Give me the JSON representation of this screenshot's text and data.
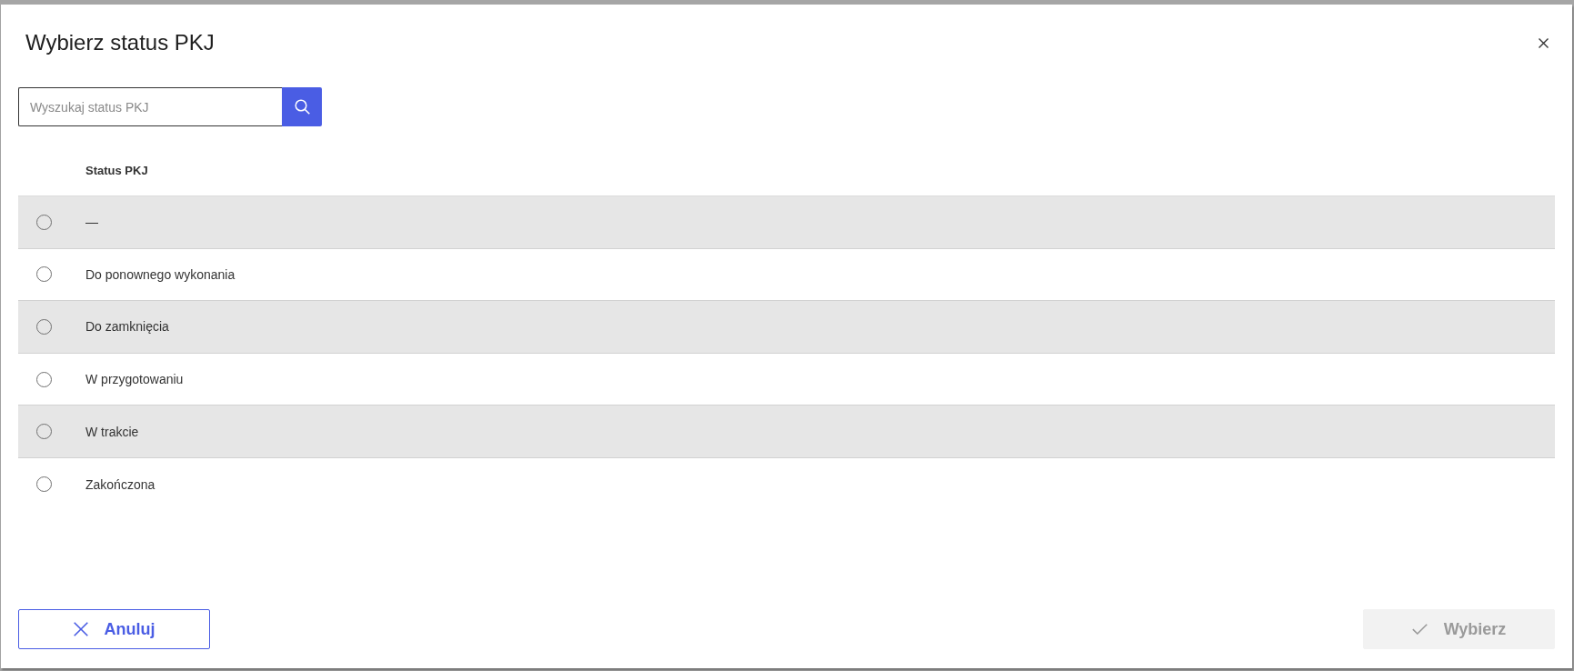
{
  "dialog": {
    "title": "Wybierz status PKJ"
  },
  "search": {
    "placeholder": "Wyszukaj status PKJ"
  },
  "table": {
    "columns": [
      "Status PKJ"
    ],
    "rows": [
      {
        "status": "—",
        "selected": false
      },
      {
        "status": "Do ponownego wykonania",
        "selected": false
      },
      {
        "status": "Do zamknięcia",
        "selected": false
      },
      {
        "status": "W przygotowaniu",
        "selected": false
      },
      {
        "status": "W trakcie",
        "selected": false
      },
      {
        "status": "Zakończona",
        "selected": false
      }
    ]
  },
  "buttons": [
    {
      "label": "Anuluj",
      "kind": "cancel",
      "disabled": false
    },
    {
      "label": "Wybierz",
      "kind": "confirm",
      "disabled": true
    }
  ]
}
